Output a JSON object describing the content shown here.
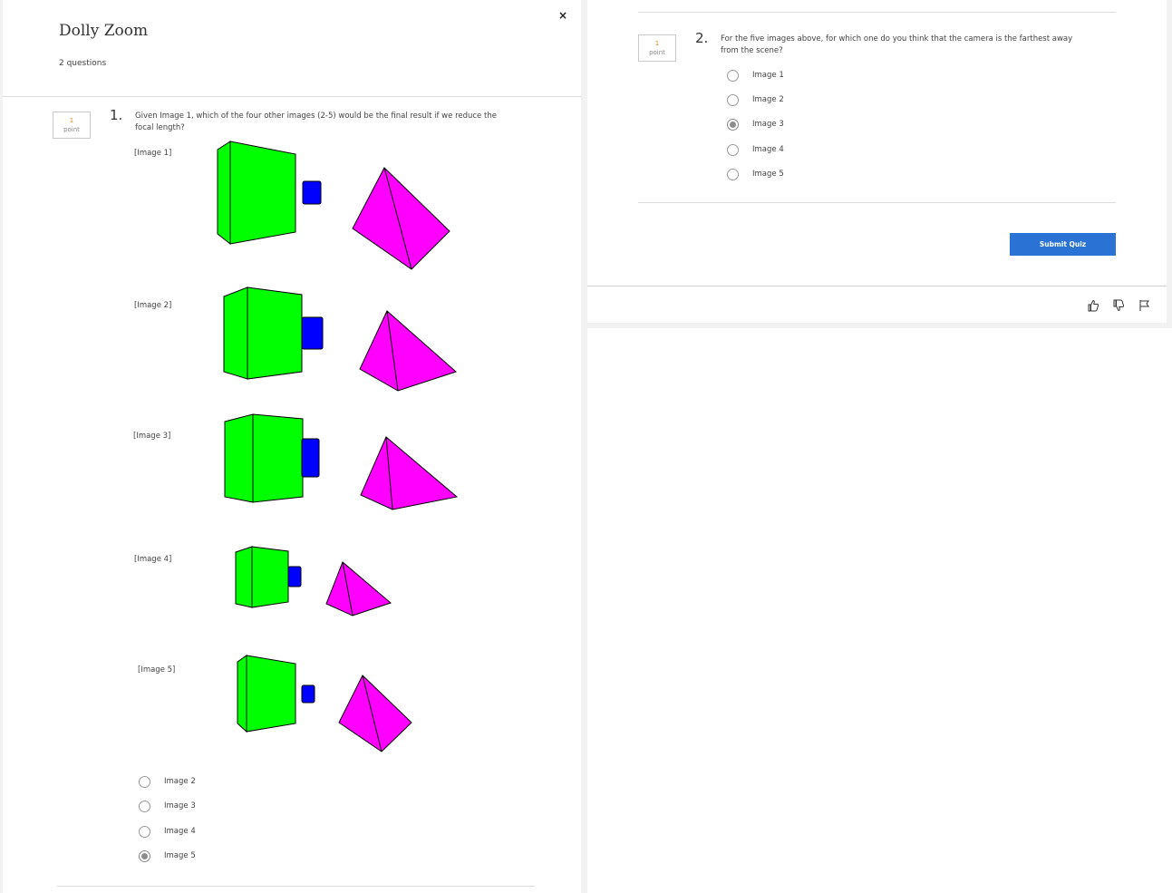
{
  "quiz": {
    "title": "Dolly Zoom",
    "subtitle": "2 questions",
    "close_icon": "×"
  },
  "question1": {
    "number": "1.",
    "points_value": "1",
    "points_unit": "point",
    "text": "Given Image 1, which of the four other images (2-5) would be the final result if we reduce the focal length?",
    "images": [
      {
        "label": "[Image 1]"
      },
      {
        "label": "[Image 2]"
      },
      {
        "label": "[Image 3]"
      },
      {
        "label": "[Image 4]"
      },
      {
        "label": "[Image 5]"
      }
    ],
    "options": [
      {
        "label": "Image 2",
        "checked": false
      },
      {
        "label": "Image 3",
        "checked": false
      },
      {
        "label": "Image 4",
        "checked": false
      },
      {
        "label": "Image 5",
        "checked": true
      }
    ]
  },
  "question2": {
    "number": "2.",
    "points_value": "1",
    "points_unit": "point",
    "text": "For the five images above, for which one do you think that the camera is the farthest away from the scene?",
    "options": [
      {
        "label": "Image 1",
        "checked": false
      },
      {
        "label": "Image 2",
        "checked": false
      },
      {
        "label": "Image 3",
        "checked": true
      },
      {
        "label": "Image 4",
        "checked": false
      },
      {
        "label": "Image 5",
        "checked": false
      }
    ]
  },
  "submit": {
    "label": "Submit Quiz",
    "color": "#2a73d4"
  },
  "feedback": {
    "icons": [
      "thumbs-up-icon",
      "thumbs-down-icon",
      "flag-icon"
    ]
  },
  "colors": {
    "cube": "#00ff00",
    "small_box": "#0000ff",
    "pyramid": "#ff00ff",
    "accent_points": "#e08a1e"
  }
}
